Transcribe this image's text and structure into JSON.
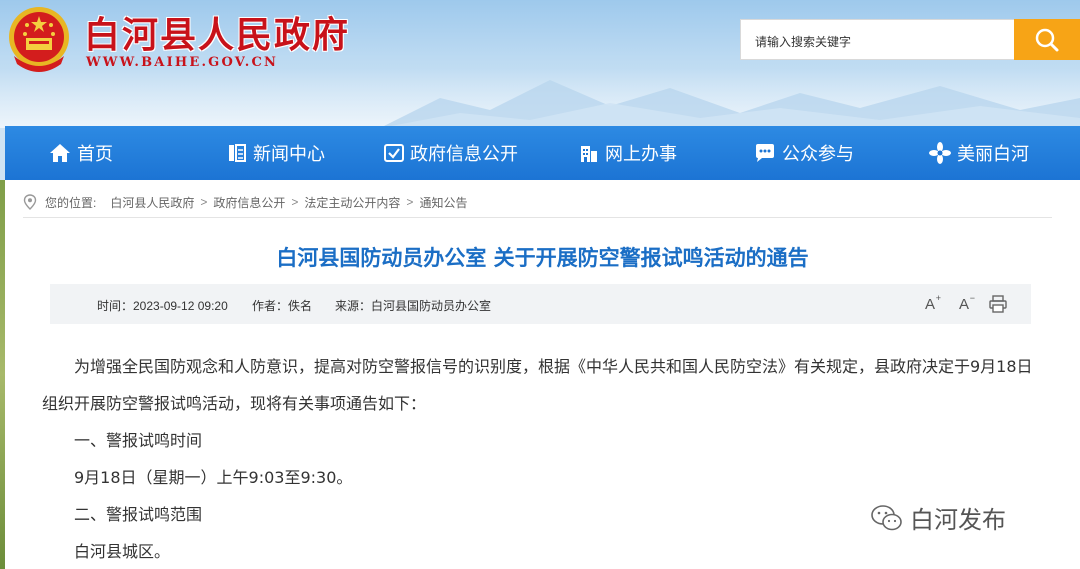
{
  "header": {
    "site_title": "白河县人民政府",
    "site_url": "WWW.BAIHE.GOV.CN",
    "search_placeholder": "请输入搜索关键字"
  },
  "nav": {
    "items": [
      {
        "label": "首页",
        "icon": "home-icon"
      },
      {
        "label": "新闻中心",
        "icon": "news-icon"
      },
      {
        "label": "政府信息公开",
        "icon": "info-open-icon"
      },
      {
        "label": "网上办事",
        "icon": "building-icon"
      },
      {
        "label": "公众参与",
        "icon": "chat-icon"
      },
      {
        "label": "美丽白河",
        "icon": "flower-icon"
      }
    ]
  },
  "breadcrumb": {
    "prefix": "您的位置:",
    "items": [
      "白河县人民政府",
      "政府信息公开",
      "法定主动公开内容",
      "通知公告"
    ],
    "separator": ">"
  },
  "article": {
    "title": "白河县国防动员办公室 关于开展防空警报试鸣活动的通告",
    "time": "时间：2023-09-12 09:20",
    "author": "作者：佚名",
    "source": "来源：白河县国防动员办公室",
    "paragraphs": [
      "为增强全民国防观念和人防意识，提高对防空警报信号的识别度，根据《中华人民共和国人民防空法》有关规定，县政府决定于9月18日",
      "组织开展防空警报试鸣活动，现将有关事项通告如下：",
      "一、警报试鸣时间",
      "9月18日（星期一）上午9:03至9:30。",
      "二、警报试鸣范围",
      "白河县城区。"
    ]
  },
  "watermark": "白河发布",
  "colors": {
    "brand_red": "#c8121a",
    "nav_blue": "#1c74d4",
    "title_blue": "#1b6ec5",
    "search_orange": "#f7a416"
  }
}
